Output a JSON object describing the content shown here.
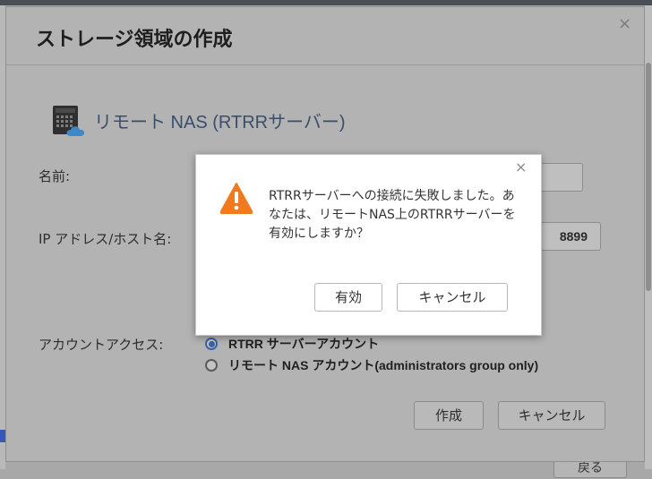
{
  "background": {
    "back_button_label": "戻る"
  },
  "dialog": {
    "title": "ストレージ領域の作成",
    "close_glyph": "×",
    "section_title": "リモート NAS (RTRRサーバー)",
    "fields": {
      "name_label": "名前:",
      "name_value": "",
      "ip_label": "IP アドレス/ホスト名:",
      "ip_value": "8899"
    },
    "account_access_label": "アカウントアクセス:",
    "account_options": [
      {
        "label": "RTRR サーバーアカウント",
        "selected": true
      },
      {
        "label": "リモート NAS アカウント(administrators group only)",
        "selected": false
      }
    ],
    "buttons": {
      "create": "作成",
      "cancel": "キャンセル"
    }
  },
  "alert": {
    "close_glyph": "×",
    "icon": "warning-icon",
    "message": "RTRRサーバーへの接続に失敗しました。あなたは、リモートNAS上のRTRRサーバーを有効にしますか？",
    "buttons": {
      "enable": "有効",
      "cancel": "キャンセル"
    }
  },
  "colors": {
    "warning": "#f07a1f",
    "accent": "#3a62a8"
  }
}
